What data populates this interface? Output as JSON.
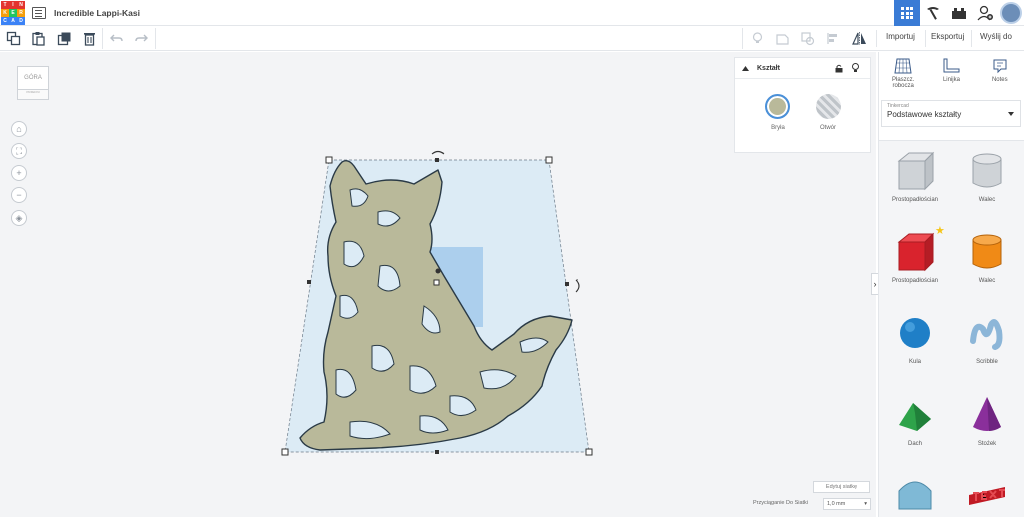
{
  "header": {
    "logo_letters": [
      "T",
      "I",
      "N",
      "K",
      "E",
      "R",
      "C",
      "A",
      "D"
    ],
    "title": "Incredible Lappi-Kasi"
  },
  "toolbar": {
    "import_label": "Importuj",
    "export_label": "Eksportuj",
    "send_label": "Wyślij do"
  },
  "viewcube": {
    "top_label": "GÓRA",
    "front_label": "PRZEDNI"
  },
  "shape_panel": {
    "title": "Kształt",
    "solid_label": "Bryła",
    "hole_label": "Otwór",
    "solid_color": "#b9b99a"
  },
  "grid_controls": {
    "edit_grid_label": "Edytuj siatkę",
    "snap_label": "Przyciąganie Do Siatki",
    "snap_value": "1,0 mm"
  },
  "right_panel": {
    "tools": [
      {
        "label": "Płaszcz. robocza"
      },
      {
        "label": "Linijka"
      },
      {
        "label": "Notes"
      }
    ],
    "library_source": "Tinkercad",
    "library_selected": "Podstawowe kształty",
    "shapes": [
      {
        "label": "Prostopadłościan"
      },
      {
        "label": "Walec"
      },
      {
        "label": "Prostopadłościan"
      },
      {
        "label": "Walec"
      },
      {
        "label": "Kula"
      },
      {
        "label": "Scribble"
      },
      {
        "label": "Dach"
      },
      {
        "label": "Stożek"
      },
      {
        "label": ""
      },
      {
        "label": ""
      }
    ]
  },
  "colors": {
    "accent": "#3a7bd5",
    "object_fill": "#b9b99a",
    "object_outline": "#2a3a46",
    "selection_fill": "#dcebf5",
    "box_red": "#d9232d",
    "cylinder_orange": "#f08a16",
    "sphere_blue": "#1f7fc7",
    "roof_green": "#2ea34a",
    "cone_purple": "#8a2f9b"
  }
}
